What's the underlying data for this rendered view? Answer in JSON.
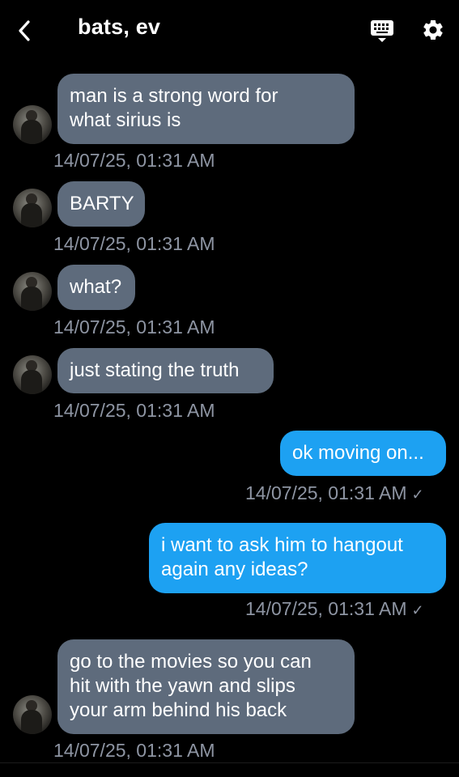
{
  "header": {
    "title": "bats, ev",
    "back_icon": "chevron-left-icon",
    "keyboard_icon": "keyboard-icon",
    "settings_icon": "gear-icon"
  },
  "colors": {
    "incoming_bubble": "#5e6b7c",
    "outgoing_bubble": "#1da1f2",
    "timestamp": "#8e95a3",
    "background": "#000000"
  },
  "messages": [
    {
      "direction": "incoming",
      "text": "man is a strong word for\nwhat sirius is",
      "time": "14/07/25, 01:31 AM"
    },
    {
      "direction": "incoming",
      "text": "BARTY",
      "time": "14/07/25, 01:31 AM"
    },
    {
      "direction": "incoming",
      "text": "what?",
      "time": "14/07/25, 01:31 AM"
    },
    {
      "direction": "incoming",
      "text": "just stating the truth",
      "time": "14/07/25, 01:31 AM"
    },
    {
      "direction": "outgoing",
      "text": "ok moving on...",
      "time": "14/07/25, 01:31 AM",
      "status": "✓"
    },
    {
      "direction": "outgoing",
      "text": "i want to ask him to hangout\nagain any ideas?",
      "time": "14/07/25, 01:31 AM",
      "status": "✓"
    },
    {
      "direction": "incoming",
      "text": "go to the movies so you can\nhit with the yawn and slips\nyour arm behind his back",
      "time": "14/07/25, 01:31 AM"
    }
  ]
}
